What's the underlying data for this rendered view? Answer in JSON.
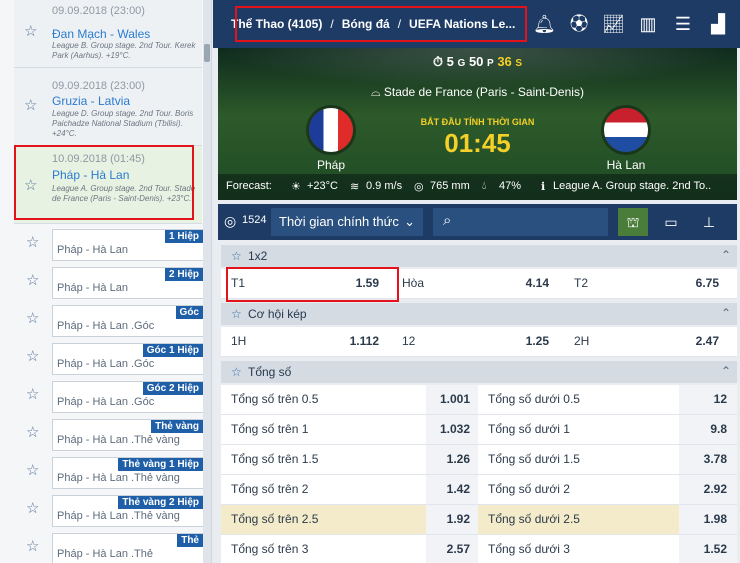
{
  "left": {
    "matches": [
      {
        "date": "09.09.2018 (23:00)",
        "teams": "Đan Mạch - Wales",
        "info": "League B. Group stage. 2nd Tour. Kerek Park (Aarhus). +19°C."
      },
      {
        "date": "09.09.2018 (23:00)",
        "teams": "Gruzia - Latvia",
        "info": "League D. Group stage. 2nd Tour. Boris Paichadze National Stadium (Tbilisi). +24°C."
      },
      {
        "date": "10.09.2018 (01:45)",
        "teams": "Pháp - Hà Lan",
        "info": "League A. Group stage. 2nd Tour. Stade de France (Paris - Saint-Denis). +23°C."
      }
    ],
    "bets": [
      {
        "tag": "1 Hiệp",
        "name": "Pháp - Hà Lan"
      },
      {
        "tag": "2 Hiệp",
        "name": "Pháp - Hà Lan"
      },
      {
        "tag": "Góc",
        "name": "Pháp - Hà Lan .Góc"
      },
      {
        "tag": "Góc 1 Hiệp",
        "name": "Pháp - Hà Lan .Góc"
      },
      {
        "tag": "Góc 2 Hiệp",
        "name": "Pháp - Hà Lan .Góc"
      },
      {
        "tag": "Thẻ vàng",
        "name": "Pháp - Hà Lan .Thẻ vàng"
      },
      {
        "tag": "Thẻ vàng 1 Hiệp",
        "name": "Pháp - Hà Lan .Thẻ vàng"
      },
      {
        "tag": "Thẻ vàng 2 Hiệp",
        "name": "Pháp - Hà Lan .Thẻ vàng"
      },
      {
        "tag": "Thẻ",
        "name": "Pháp - Hà Lan .Thẻ"
      }
    ]
  },
  "breadcrumb": {
    "a": "Thể Thao (4105)",
    "b": "Bóng đá",
    "c": "UEFA Nations Le...",
    "sep": "/"
  },
  "match": {
    "timer_g": "5",
    "timer_g_unit": "G",
    "timer_p": "50",
    "timer_p_unit": "P",
    "timer_s": "36",
    "timer_s_unit": "S",
    "venue": "Stade de France (Paris - Saint-Denis)",
    "home": "Pháp",
    "away": "Hà Lan",
    "clock_label": "BẮT ĐẦU TÍNH THỜI GIAN",
    "clock": "01:45",
    "forecast_label": "Forecast:",
    "temp": "+23°C",
    "wind": "0.9 m/s",
    "pressure": "765 mm",
    "humidity": "47%",
    "league": "League A. Group stage. 2nd To.."
  },
  "filter": {
    "count": "1524",
    "dropdown": "Thời gian chính thức"
  },
  "markets": {
    "m1": {
      "title": "1x2",
      "row": {
        "l1": "T1",
        "v1": "1.59",
        "l2": "Hòa",
        "v2": "4.14",
        "l3": "T2",
        "v3": "6.75"
      }
    },
    "m2": {
      "title": "Cơ hội kép",
      "row": {
        "l1": "1H",
        "v1": "1.112",
        "l2": "12",
        "v2": "1.25",
        "l3": "2H",
        "v3": "2.47"
      }
    },
    "m3": {
      "title": "Tổng số",
      "rows": [
        {
          "l1": "Tổng số trên 0.5",
          "v1": "1.001",
          "l2": "Tổng số dưới 0.5",
          "v2": "12"
        },
        {
          "l1": "Tổng số trên 1",
          "v1": "1.032",
          "l2": "Tổng số dưới 1",
          "v2": "9.8"
        },
        {
          "l1": "Tổng số trên 1.5",
          "v1": "1.26",
          "l2": "Tổng số dưới 1.5",
          "v2": "3.78"
        },
        {
          "l1": "Tổng số trên 2",
          "v1": "1.42",
          "l2": "Tổng số dưới 2",
          "v2": "2.92"
        },
        {
          "l1": "Tổng số trên 2.5",
          "v1": "1.92",
          "l2": "Tổng số dưới 2.5",
          "v2": "1.98"
        },
        {
          "l1": "Tổng số trên 3",
          "v1": "2.57",
          "l2": "Tổng số dưới 3",
          "v2": "1.52"
        }
      ]
    }
  }
}
